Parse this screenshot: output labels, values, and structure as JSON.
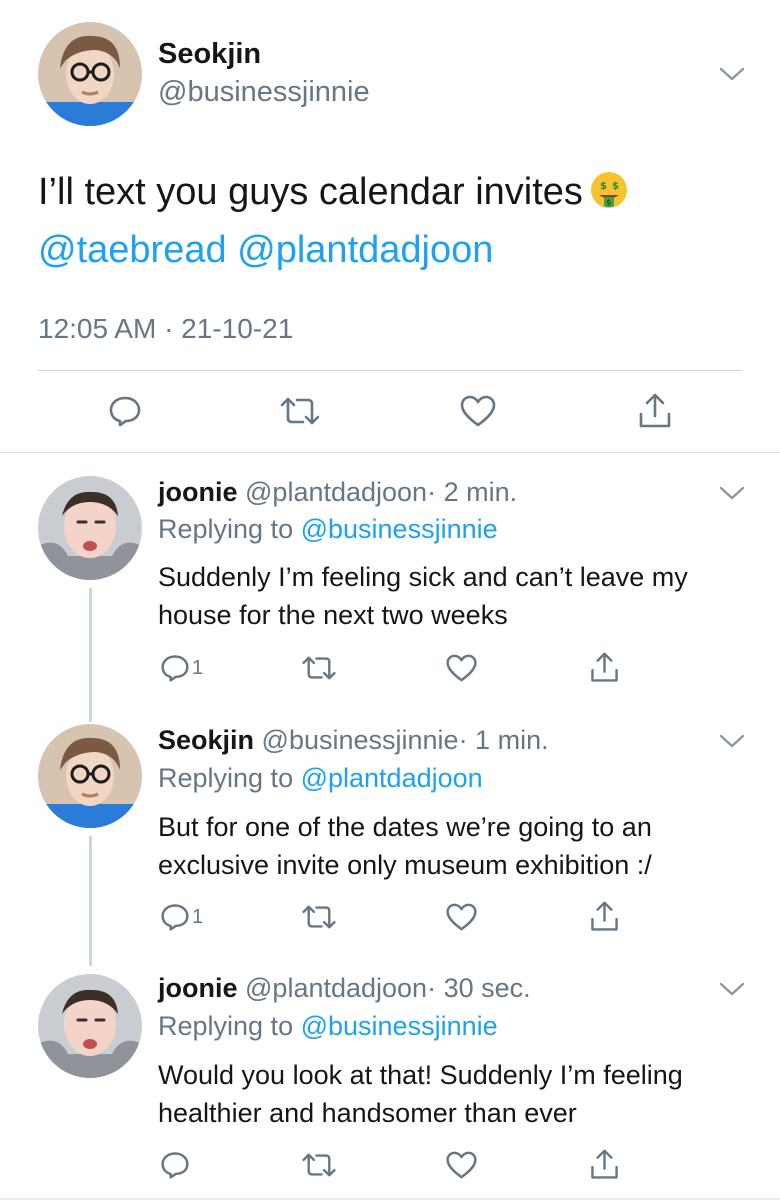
{
  "main_tweet": {
    "author_name": "Seokjin",
    "author_handle": "@businessjinnie",
    "text": "I’ll text you guys calendar invites",
    "emoji": "money-mouth-face",
    "mentions": "@taebread @plantdadjoon",
    "timestamp": "12:05 AM · 21-10-21"
  },
  "replies": [
    {
      "author_name": "joonie",
      "author_handle": "@plantdadjoon",
      "time": "· 2 min.",
      "replying_prefix": "Replying to ",
      "replying_to": "@businessjinnie",
      "text": "Suddenly I’m feeling sick and can’t leave my house for the next two weeks",
      "reply_count": "1"
    },
    {
      "author_name": "Seokjin",
      "author_handle": "@businessjinnie",
      "time": "· 1 min.",
      "replying_prefix": "Replying to ",
      "replying_to": "@plantdadjoon",
      "text": "But for one of the dates we’re going to an exclusive invite only museum exhibition :/",
      "reply_count": "1"
    },
    {
      "author_name": "joonie",
      "author_handle": "@plantdadjoon",
      "time": "· 30 sec.",
      "replying_prefix": "Replying to ",
      "replying_to": "@businessjinnie",
      "text": "Would you look at that! Suddenly I’m feeling healthier and handsomer than ever",
      "reply_count": ""
    }
  ],
  "colors": {
    "link": "#1da1f2",
    "secondary_text": "#657786",
    "primary_text": "#14171a",
    "divider": "#ccd6dd"
  },
  "icons": [
    "reply-icon",
    "retweet-icon",
    "like-icon",
    "share-icon",
    "chevron-down-icon"
  ]
}
